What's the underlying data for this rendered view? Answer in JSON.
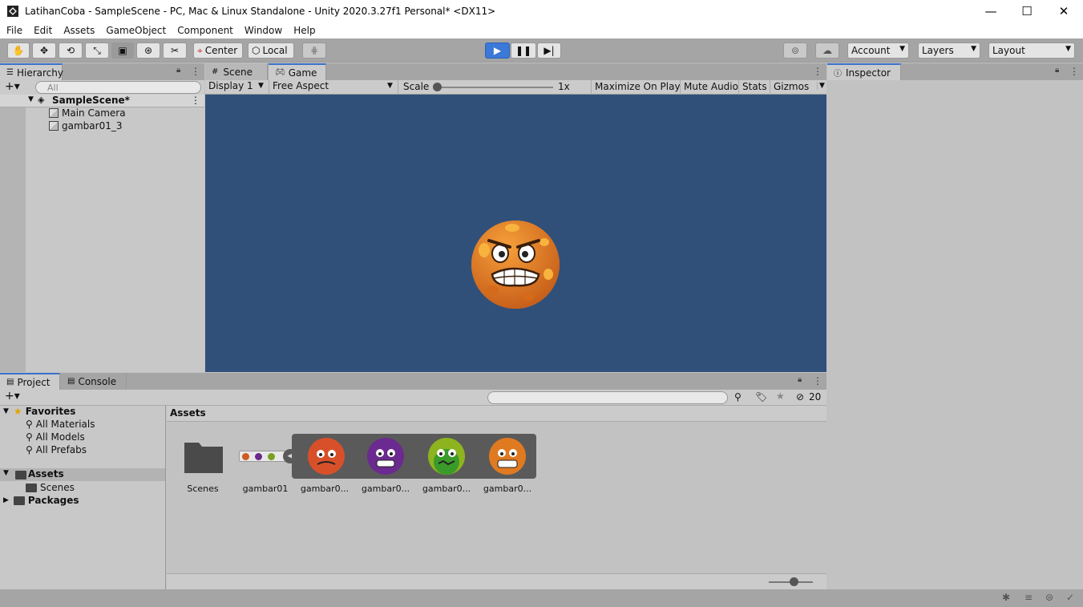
{
  "window": {
    "title": "LatihanCoba - SampleScene - PC, Mac & Linux Standalone - Unity 2020.3.27f1 Personal* <DX11>",
    "minimize": "—",
    "maximize": "☐",
    "close": "✕"
  },
  "menu": [
    "File",
    "Edit",
    "Assets",
    "GameObject",
    "Component",
    "Window",
    "Help"
  ],
  "toolbar": {
    "tools": [
      "hand-tool",
      "move-tool",
      "rotate-tool",
      "scale-tool",
      "rect-tool",
      "transform-tool",
      "custom-tool"
    ],
    "pivot_label": "Center",
    "space_label": "Local",
    "account_label": "Account",
    "layers_label": "Layers",
    "layout_label": "Layout"
  },
  "hierarchy": {
    "tab_label": "Hierarchy",
    "search_placeholder": "All",
    "scene_name": "SampleScene*",
    "items": [
      "Main Camera",
      "gambar01_3"
    ]
  },
  "scene_view": {
    "tabs": [
      "Scene",
      "Game"
    ],
    "display_label": "Display 1",
    "aspect_label": "Free Aspect",
    "scale_label": "Scale",
    "scale_value": "1x",
    "toggles": [
      "Maximize On Play",
      "Mute Audio",
      "Stats",
      "Gizmos"
    ],
    "background_color": "#30507a"
  },
  "inspector": {
    "tab_label": "Inspector"
  },
  "project": {
    "tabs": [
      "Project",
      "Console"
    ],
    "hidden_count": "20",
    "favorites_label": "Favorites",
    "favorites": [
      "All Materials",
      "All Models",
      "All Prefabs"
    ],
    "assets_label": "Assets",
    "asset_folders": [
      "Scenes"
    ],
    "packages_label": "Packages",
    "breadcrumb": "Assets",
    "asset_items": [
      "Scenes",
      "gambar01",
      "gambar0...",
      "gambar0...",
      "gambar0...",
      "gambar0..."
    ]
  }
}
